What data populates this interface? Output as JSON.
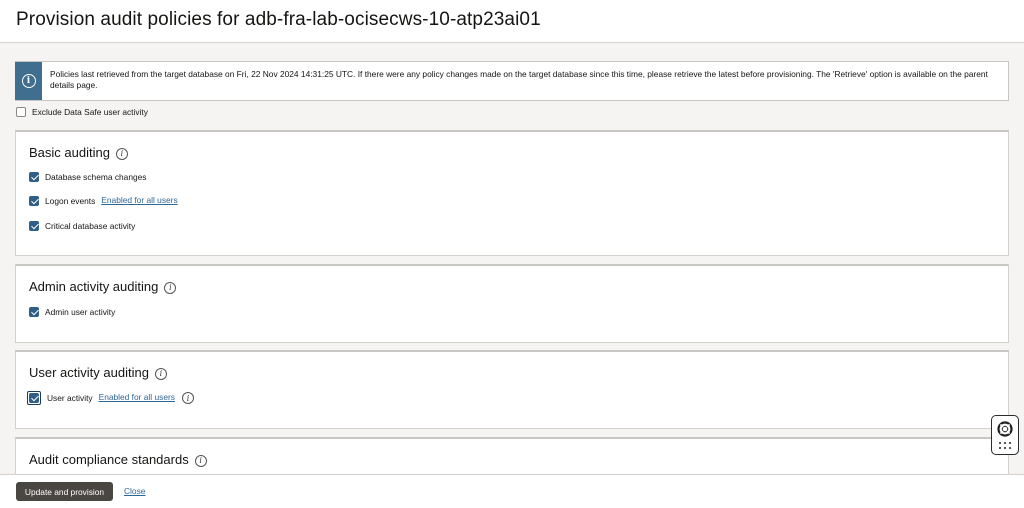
{
  "page": {
    "title": "Provision audit policies for adb-fra-lab-ocisecws-10-atp23ai01"
  },
  "notice": {
    "text": "Policies last retrieved from the target database on Fri, 22 Nov 2024 14:31:25 UTC. If there were any policy changes made on the target database since this time, please retrieve the latest before provisioning. The 'Retrieve' option is available on the parent details page."
  },
  "exclude_datasafe": {
    "label": "Exclude Data Safe user activity",
    "checked": false
  },
  "sections": {
    "basic": {
      "title": "Basic auditing",
      "items": [
        {
          "label": "Database schema changes",
          "checked": true
        },
        {
          "label": "Logon events",
          "checked": true,
          "link": "Enabled for all users"
        },
        {
          "label": "Critical database activity",
          "checked": true
        }
      ]
    },
    "admin": {
      "title": "Admin activity auditing",
      "items": [
        {
          "label": "Admin user activity",
          "checked": true
        }
      ]
    },
    "user": {
      "title": "User activity auditing",
      "items": [
        {
          "label": "User activity",
          "checked": true,
          "link": "Enabled for all users"
        }
      ]
    },
    "compliance": {
      "title": "Audit compliance standards"
    }
  },
  "footer": {
    "primary_label": "Update and provision",
    "close_label": "Close"
  },
  "colors": {
    "accent": "#2f5e86",
    "notice_bar": "#3f6e8e",
    "link": "#2e6695",
    "primary_button": "#4a4743"
  },
  "icons": {
    "notice": "info-icon",
    "section_help": "help-info-icon",
    "help_widget": "lifebuoy-icon",
    "help_menu": "grid-dots-icon"
  }
}
